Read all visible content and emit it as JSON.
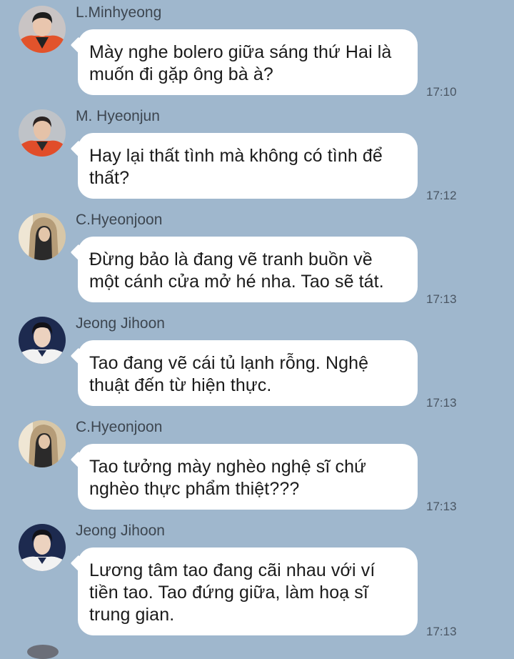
{
  "chat": {
    "messages": [
      {
        "sender": "L.Minhyeong",
        "text": "Mày nghe bolero giữa sáng thứ Hai là muốn đi gặp ông bà à?",
        "time": "17:10",
        "avatar": "avatar-orange-jacket"
      },
      {
        "sender": "M. Hyeonjun",
        "text": "Hay lại thất tình mà không có tình để thất?",
        "time": "17:12",
        "avatar": "avatar-orange-jacket-2"
      },
      {
        "sender": "C.Hyeonjoon",
        "text": "Đừng bảo là đang vẽ tranh buồn về một cánh cửa mở hé nha. Tao sẽ tát.",
        "time": "17:13",
        "avatar": "avatar-beige-hood"
      },
      {
        "sender": "Jeong Jihoon",
        "text": "Tao đang vẽ cái tủ lạnh rỗng. Nghệ thuật đến từ hiện thực.",
        "time": "17:13",
        "avatar": "avatar-navy-jersey"
      },
      {
        "sender": "C.Hyeonjoon",
        "text": "Tao tưởng mày nghèo nghệ sĩ chứ nghèo thực phẩm thiệt???",
        "time": "17:13",
        "avatar": "avatar-beige-hood"
      },
      {
        "sender": "Jeong Jihoon",
        "text": "Lương tâm tao đang cãi nhau với ví tiền tao. Tao đứng giữa, làm hoạ sĩ trung gian.",
        "time": "17:13",
        "avatar": "avatar-navy-jersey"
      }
    ]
  },
  "colors": {
    "background": "#9fb7cd",
    "bubble": "#ffffff",
    "sender_text": "#3d4650",
    "time_text": "#4a5663"
  }
}
